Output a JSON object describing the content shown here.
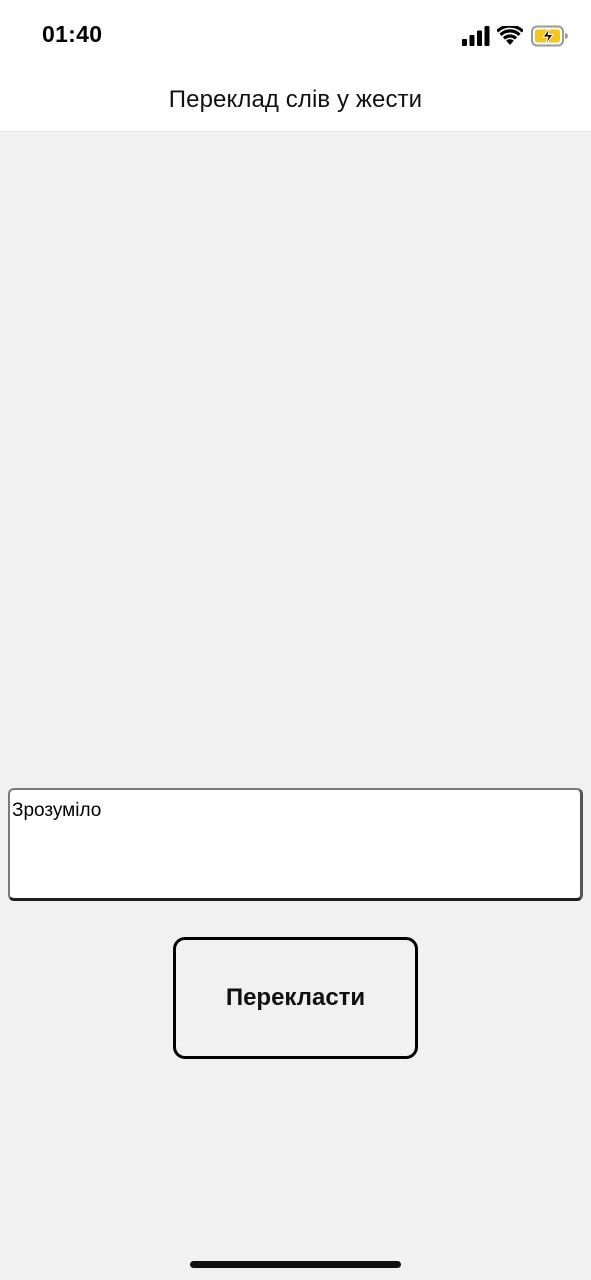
{
  "status_bar": {
    "time": "01:40",
    "icons": [
      "signal-icon",
      "wifi-icon",
      "battery-charging-icon"
    ],
    "battery_color": "#f5c518"
  },
  "nav": {
    "title": "Переклад слів у жести"
  },
  "input": {
    "value": "Зрозуміло"
  },
  "translate_button": {
    "label": "Перекласти"
  },
  "colors": {
    "background": "#f1f1f1",
    "header": "#ffffff"
  }
}
